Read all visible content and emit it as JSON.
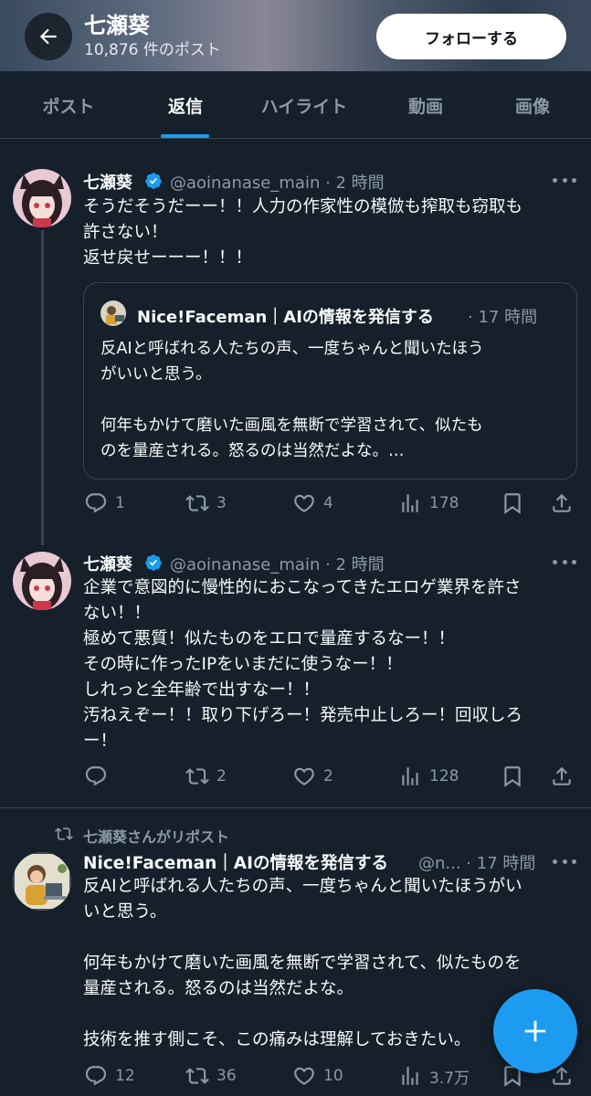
{
  "header": {
    "name": "七瀬葵",
    "post_count": "10,876 件のポスト",
    "follow_label": "フォローする"
  },
  "tabs": [
    {
      "label": "ポスト"
    },
    {
      "label": "返信"
    },
    {
      "label": "ハイライト"
    },
    {
      "label": "動画"
    },
    {
      "label": "画像"
    }
  ],
  "tweets": [
    {
      "name": "七瀬葵",
      "handle": "@aoinanase_main · 2 時間",
      "text": "そうだそうだーー！！人力の作家性の模倣も搾取も窃取も\n許さない！\n返せ戻せーーー！！！",
      "quote": {
        "name": "Nice!Faceman｜AIの情報を発信する",
        "time": "· 17 時間",
        "text": "反AIと呼ばれる人たちの声、一度ちゃんと聞いたほう\nがいいと思う。\n\n何年もかけて磨いた画風を無断で学習されて、似たも\nのを量産される。怒るのは当然だよな。…"
      },
      "stats": {
        "replies": "1",
        "reposts": "3",
        "likes": "4",
        "views": "178"
      }
    },
    {
      "name": "七瀬葵",
      "handle": "@aoinanase_main · 2 時間",
      "text": "企業で意図的に慢性的におこなってきたエロゲ業界を許さ\nない！！\n極めて悪質！似たものをエロで量産するなー！！\nその時に作ったIPをいまだに使うなー！！\nしれっと全年齢で出すなー！！\n汚ねえぞー！！取り下げろー！発売中止しろー！回収しろ\nー！",
      "stats": {
        "replies": "",
        "reposts": "2",
        "likes": "2",
        "views": "128"
      }
    },
    {
      "repost_label": "七瀬葵さんがリポスト",
      "name": "Nice!Faceman｜AIの情報を発信する",
      "handle": "@n... · 17 時間",
      "text": "反AIと呼ばれる人たちの声、一度ちゃんと聞いたほうがい\nいと思う。\n\n何年もかけて磨いた画風を無断で学習されて、似たものを\n量産される。怒るのは当然だよな。\n\n技術を推す側こそ、この痛みは理解しておきたい。",
      "stats": {
        "replies": "12",
        "reposts": "36",
        "likes": "10",
        "views": "3.7万"
      }
    }
  ],
  "colors": {
    "background": "#15202b",
    "accent": "#1d9bf0",
    "muted": "#8b98a5",
    "border": "#38444d"
  }
}
